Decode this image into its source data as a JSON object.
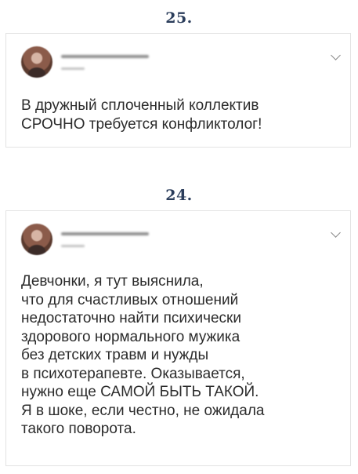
{
  "posts": [
    {
      "number": "25.",
      "lines": [
        "В дружный сплоченный коллектив",
        "СРОЧНО требуется конфликтолог!"
      ]
    },
    {
      "number": "24.",
      "lines": [
        "Девчонки, я тут выяснила,",
        "что для счастливых отношений",
        "недостаточно найти психически",
        "здорового нормального мужика",
        "без детских травм и нужды",
        "в психотерапевте. Оказывается,",
        "нужно еще САМОЙ БЫТЬ ТАКОЙ.",
        "Я в шоке, если честно, не ожидала",
        "такого поворота."
      ]
    }
  ],
  "icons": {
    "avatar": "user-avatar",
    "menu": "chevron-down-icon"
  }
}
